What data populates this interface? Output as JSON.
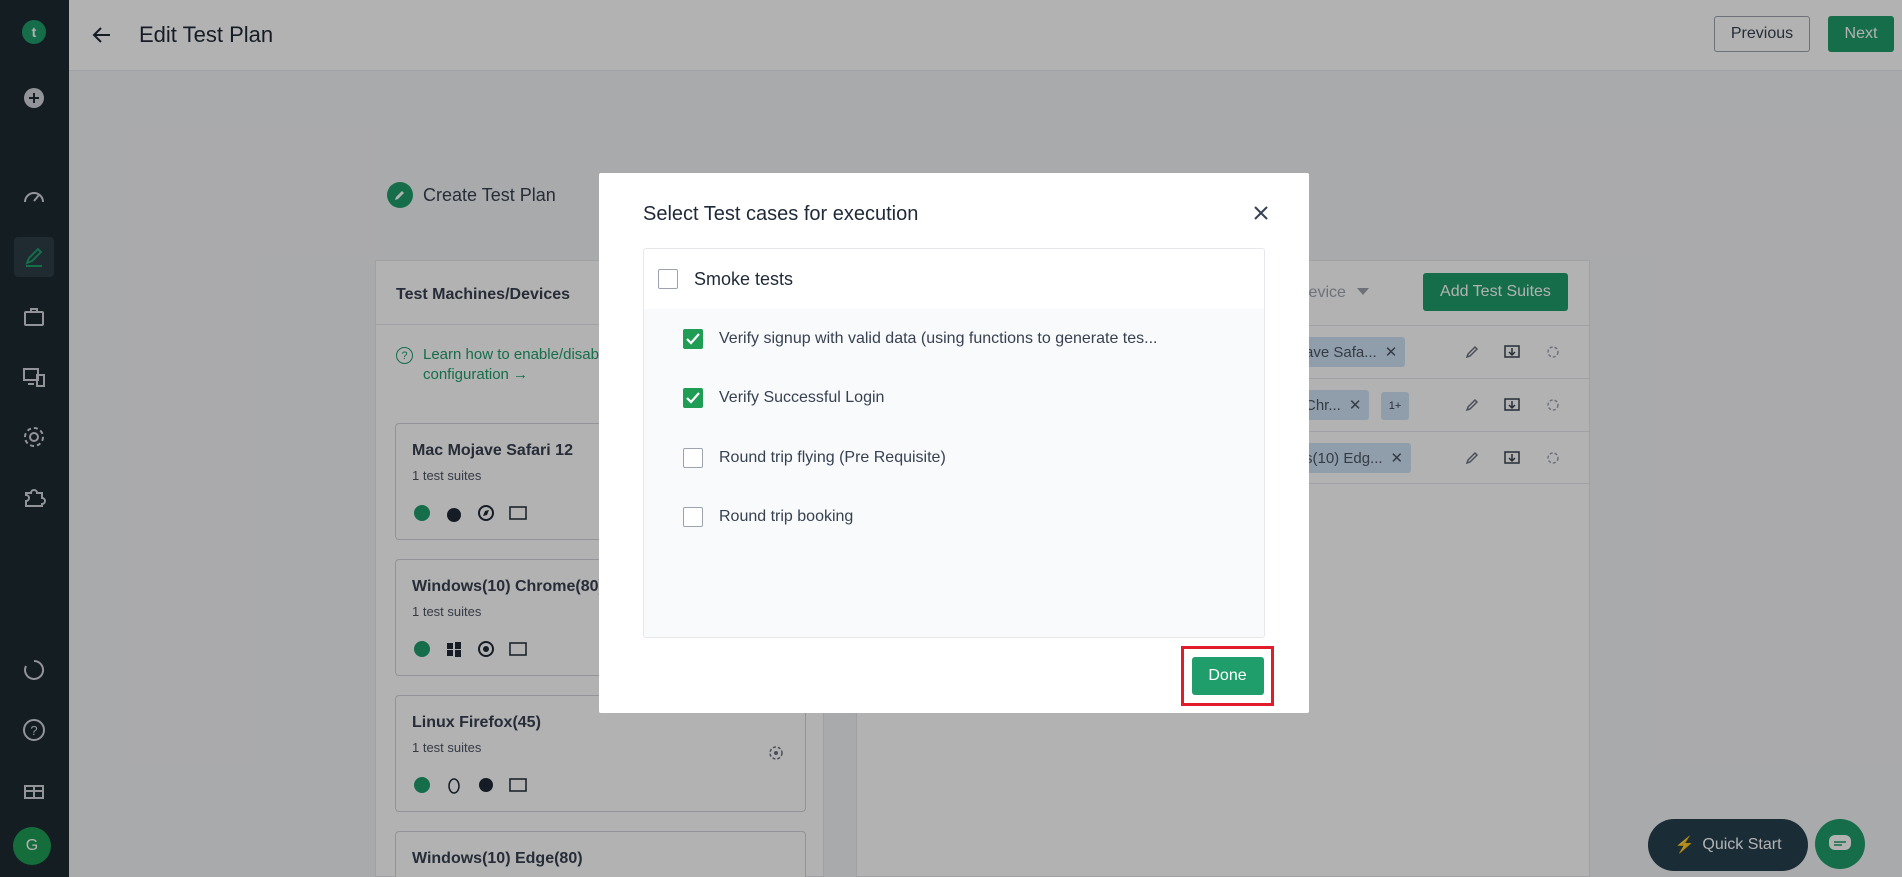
{
  "header": {
    "title": "Edit Test Plan",
    "previous_label": "Previous",
    "next_label": "Next"
  },
  "sidebar": {
    "avatar_letter": "G"
  },
  "background": {
    "create_plan_label": "Create Test Plan",
    "machines_heading": "Test Machines/Devices",
    "learn_link_line1": "Learn how to enable/disab",
    "learn_link_line2": "configuration →",
    "machines": [
      {
        "name": "Mac Mojave Safari 12",
        "sub": "1 test suites"
      },
      {
        "name": "Windows(10) Chrome(80)",
        "sub": "1 test suites"
      },
      {
        "name": "Linux Firefox(45)",
        "sub": "1 test suites"
      },
      {
        "name": "Windows(10) Edge(80)",
        "sub": ""
      }
    ],
    "device_dropdown_label": "Device",
    "add_suites_label": "Add Test Suites",
    "rows": [
      {
        "chip": "ave Safa...",
        "more": ""
      },
      {
        "chip": "Chr...",
        "more": "1+"
      },
      {
        "chip": "s(10) Edg...",
        "more": ""
      }
    ],
    "quick_start_label": "Quick Start"
  },
  "modal": {
    "title": "Select Test cases for execution",
    "suite": {
      "label": "Smoke tests",
      "checked": false
    },
    "cases": [
      {
        "label": "Verify signup with valid data (using functions to generate tes...",
        "checked": true
      },
      {
        "label": "Verify Successful Login",
        "checked": true
      },
      {
        "label": "Round trip flying (Pre Requisite)",
        "checked": false
      },
      {
        "label": "Round trip booking",
        "checked": false
      }
    ],
    "done_label": "Done"
  },
  "colors": {
    "brand_green": "#1f9d6b",
    "sidebar_bg": "#1c2a32",
    "highlight_red": "#e11d2b"
  }
}
